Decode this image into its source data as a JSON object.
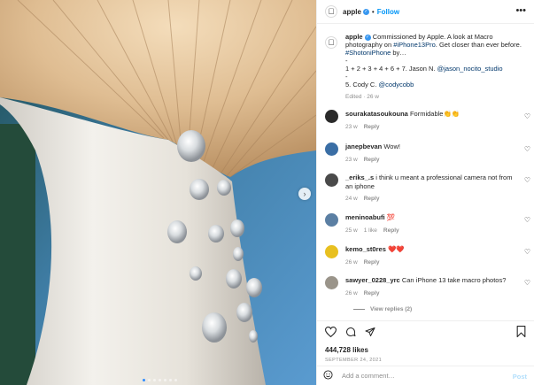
{
  "header": {
    "logo_icon": "apple-logo-icon",
    "username": "apple",
    "separator": "•",
    "follow_label": "Follow",
    "more_icon": "more-options-icon"
  },
  "caption": {
    "username": "apple",
    "text_1": "Commissioned by Apple. A look at Macro photography on",
    "hashtag_1": "#iPhone13Pro",
    "text_2": ". Get closer than ever before.",
    "hashtag_2": "#ShotoniPhone",
    "text_3": " by…",
    "line_dash_1": "-",
    "credit_1": "1 + 2 + 3 + 4 + 6 + 7. Jason N.",
    "credit_1_handle": "@jason_nocito_studio",
    "line_dash_2": "-",
    "credit_2": "5. Cody C.",
    "credit_2_handle": "@codycobb",
    "edited_label": "Edited",
    "edited_sep": "·",
    "edited_time": "26 w"
  },
  "comments": [
    {
      "user": "sourakatasoukouna",
      "text": "Formidable👏👏",
      "time": "23 w",
      "likes": "",
      "reply": "Reply",
      "avatar_color": "#2a2a2a"
    },
    {
      "user": "janepbevan",
      "text": "Wow!",
      "time": "23 w",
      "likes": "",
      "reply": "Reply",
      "avatar_color": "#3a6ea5"
    },
    {
      "user": "_eriks_.s",
      "text": "i think u meant a professional camera not from an iphone",
      "time": "24 w",
      "likes": "",
      "reply": "Reply",
      "avatar_color": "#4a4a4a"
    },
    {
      "user": "meninoabufi",
      "text": "💯",
      "time": "25 w",
      "likes": "1 like",
      "reply": "Reply",
      "avatar_color": "#5b7fa3"
    },
    {
      "user": "kemo_st0res",
      "text": "❤️❤️",
      "time": "26 w",
      "likes": "",
      "reply": "Reply",
      "avatar_color": "#e8c020"
    },
    {
      "user": "sawyer_0228_yrc",
      "text": "Can iPhone 13 take macro photos?",
      "time": "26 w",
      "likes": "",
      "reply": "Reply",
      "avatar_color": "#9a948a"
    }
  ],
  "view_replies_label": "View replies (2)",
  "actions": {
    "like_icon": "heart-icon",
    "comment_icon": "comment-icon",
    "share_icon": "share-icon",
    "save_icon": "bookmark-icon"
  },
  "likes_count": "444,728 likes",
  "post_date": "SEPTEMBER 24, 2021",
  "add_comment": {
    "emoji_icon": "emoji-icon",
    "placeholder": "Add a comment…",
    "post_label": "Post"
  },
  "carousel": {
    "next_icon": "chevron-right-icon",
    "slide_count": 7,
    "active_index": 0
  },
  "colors": {
    "accent": "#0095f6",
    "link": "#00376b",
    "muted": "#8e8e8e",
    "post_disabled": "#b2dffc"
  }
}
